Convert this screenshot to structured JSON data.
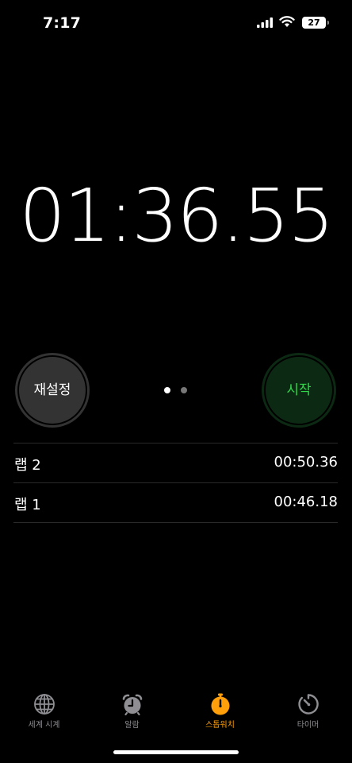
{
  "status_bar": {
    "time": "7:17",
    "battery_level": "27",
    "icons": [
      "signal-icon",
      "wifi-icon",
      "battery-icon"
    ]
  },
  "stopwatch": {
    "display": "01:36.55"
  },
  "controls": {
    "reset_label": "재설정",
    "start_label": "시작",
    "page_count": 2,
    "active_page": 1,
    "colors": {
      "start_text": "#32d74b",
      "start_bg": "#0c2a13",
      "reset_bg": "#333333"
    }
  },
  "laps": [
    {
      "label": "랩 2",
      "time": "00:50.36"
    },
    {
      "label": "랩 1",
      "time": "00:46.18"
    }
  ],
  "tab_bar": {
    "active_color": "#ff9f0a",
    "tabs": [
      {
        "label": "세계 시계",
        "icon": "globe-icon"
      },
      {
        "label": "알람",
        "icon": "alarm-clock-icon"
      },
      {
        "label": "스톱워치",
        "icon": "stopwatch-icon",
        "active": true
      },
      {
        "label": "타이머",
        "icon": "timer-icon"
      }
    ]
  }
}
